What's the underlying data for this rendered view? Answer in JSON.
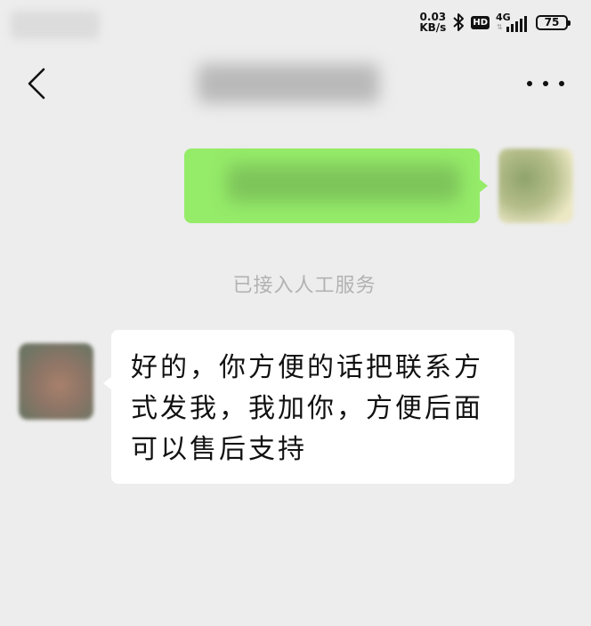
{
  "status_bar": {
    "net_speed_value": "0.03",
    "net_speed_unit": "KB/s",
    "hd_badge": "HD",
    "network_type": "4G",
    "battery_level": "75",
    "icons": [
      "bluetooth-icon",
      "signal-icon",
      "battery-icon"
    ]
  },
  "nav": {
    "back_icon": "chevron-left-icon",
    "more_icon": "more-horizontal-icon"
  },
  "messages": [
    {
      "direction": "outgoing",
      "text_blurred": true
    },
    {
      "direction": "system",
      "text": "已接入人工服务"
    },
    {
      "direction": "incoming",
      "text": "好的，你方便的话把联系方式发我，我加你，方便后面可以售后支持"
    }
  ],
  "colors": {
    "background": "#ededed",
    "outgoing_bubble": "#95ec69",
    "incoming_bubble": "#ffffff",
    "system_text": "#b2b2b2"
  }
}
